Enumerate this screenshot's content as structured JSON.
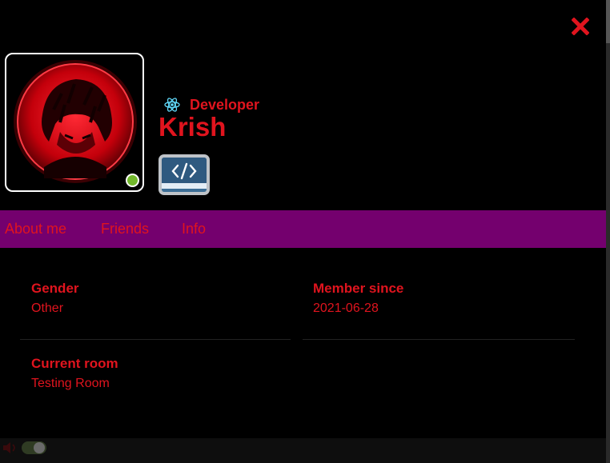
{
  "profile": {
    "role": "Developer",
    "username": "Krish",
    "status": "online",
    "status_color": "#72b82c"
  },
  "tabs": [
    "About me",
    "Friends",
    "Info"
  ],
  "fields": {
    "gender": {
      "label": "Gender",
      "value": "Other"
    },
    "member_since": {
      "label": "Member since",
      "value": "2021-06-28"
    },
    "current_room": {
      "label": "Current room",
      "value": "Testing Room"
    }
  },
  "colors": {
    "accent": "#e0141e",
    "tab_bar": "#74006e",
    "background": "#000000"
  },
  "icons": {
    "close": "close-icon",
    "role": "react-atom-icon",
    "badge": "code-badge-icon",
    "sound": "speaker-icon"
  }
}
